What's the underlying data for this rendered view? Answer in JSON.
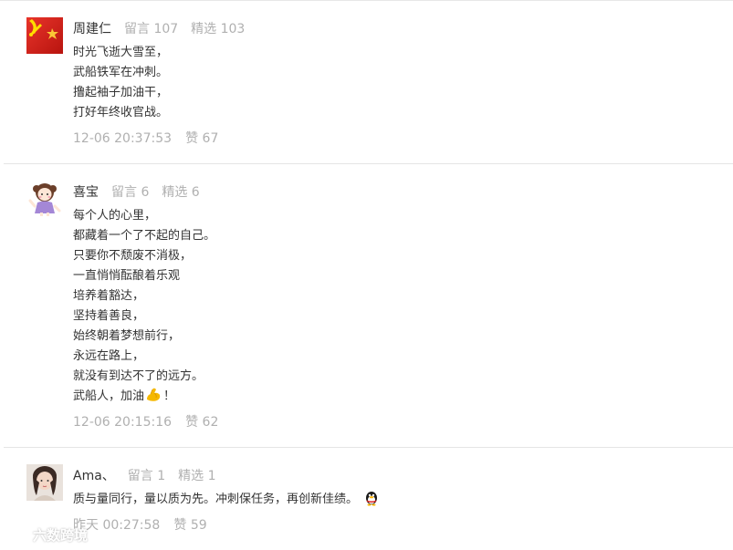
{
  "comments": [
    {
      "name": "周建仁",
      "messages_label": "留言 107",
      "featured_label": "精选 103",
      "lines": [
        "时光飞逝大雪至，",
        "武船铁军在冲刺。",
        "撸起袖子加油干，",
        "打好年终收官战。"
      ],
      "time": "12-06 20:37:53",
      "likes": "赞 67",
      "avatar_icon": "red-flag-avatar-icon"
    },
    {
      "name": "喜宝",
      "messages_label": "留言 6",
      "featured_label": "精选 6",
      "lines": [
        "每个人的心里，",
        "都藏着一个了不起的自己。",
        "只要你不颓废不消极，",
        "一直悄悄酝酿着乐观",
        "培养着豁达，",
        "坚持着善良，",
        "始终朝着梦想前行，",
        "永远在路上，",
        "就没有到达不了的远方。"
      ],
      "last_line_before_emoji": "武船人，加油",
      "last_line_after_emoji": "！",
      "emoji": "flexed-biceps-icon",
      "time": "12-06 20:15:16",
      "likes": "赞 62",
      "avatar_icon": "cartoon-girl-avatar-icon"
    },
    {
      "name": "Ama、",
      "messages_label": "留言 1",
      "featured_label": "精选 1",
      "line": "质与量同行，量以质为先。冲刺保任务，再创新佳绩。",
      "emoji": "penguin-icon",
      "time": "昨天 00:27:58",
      "likes": "赞 59",
      "avatar_icon": "photo-avatar-icon"
    }
  ],
  "watermark": {
    "text": "六数跨境",
    "logo_icon": "watermark-logo-icon"
  },
  "colors": {
    "text": "#333333",
    "muted": "#b0b0b0",
    "divider": "#e5e5e5",
    "flag_red": "#d9261c",
    "star_yellow": "#ffde00"
  }
}
